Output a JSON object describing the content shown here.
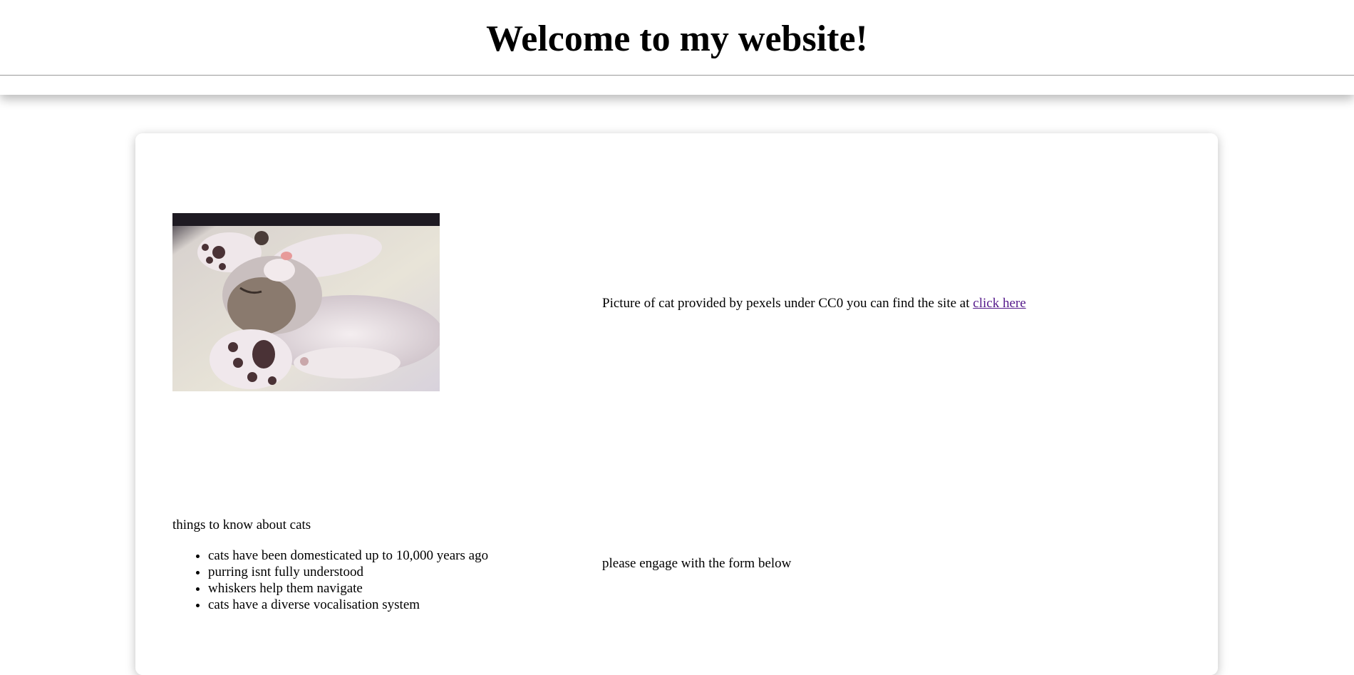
{
  "header": {
    "title": "Welcome to my website!"
  },
  "main": {
    "image": {
      "subject": "sleeping kitten photo"
    },
    "credit": {
      "text": "Picture of cat provided by pexels under CC0 you can find the site at ",
      "link_label": "click here"
    },
    "facts": {
      "title": "things to know about cats",
      "items": [
        "cats have been domesticated up to 10,000 years ago",
        "purring isnt fully understood",
        "whiskers help them navigate",
        "cats have a diverse vocalisation system"
      ]
    },
    "form_prompt": "please engage with the form below"
  },
  "colors": {
    "visited_link": "#551a8b",
    "divider": "#9a9a9a"
  }
}
